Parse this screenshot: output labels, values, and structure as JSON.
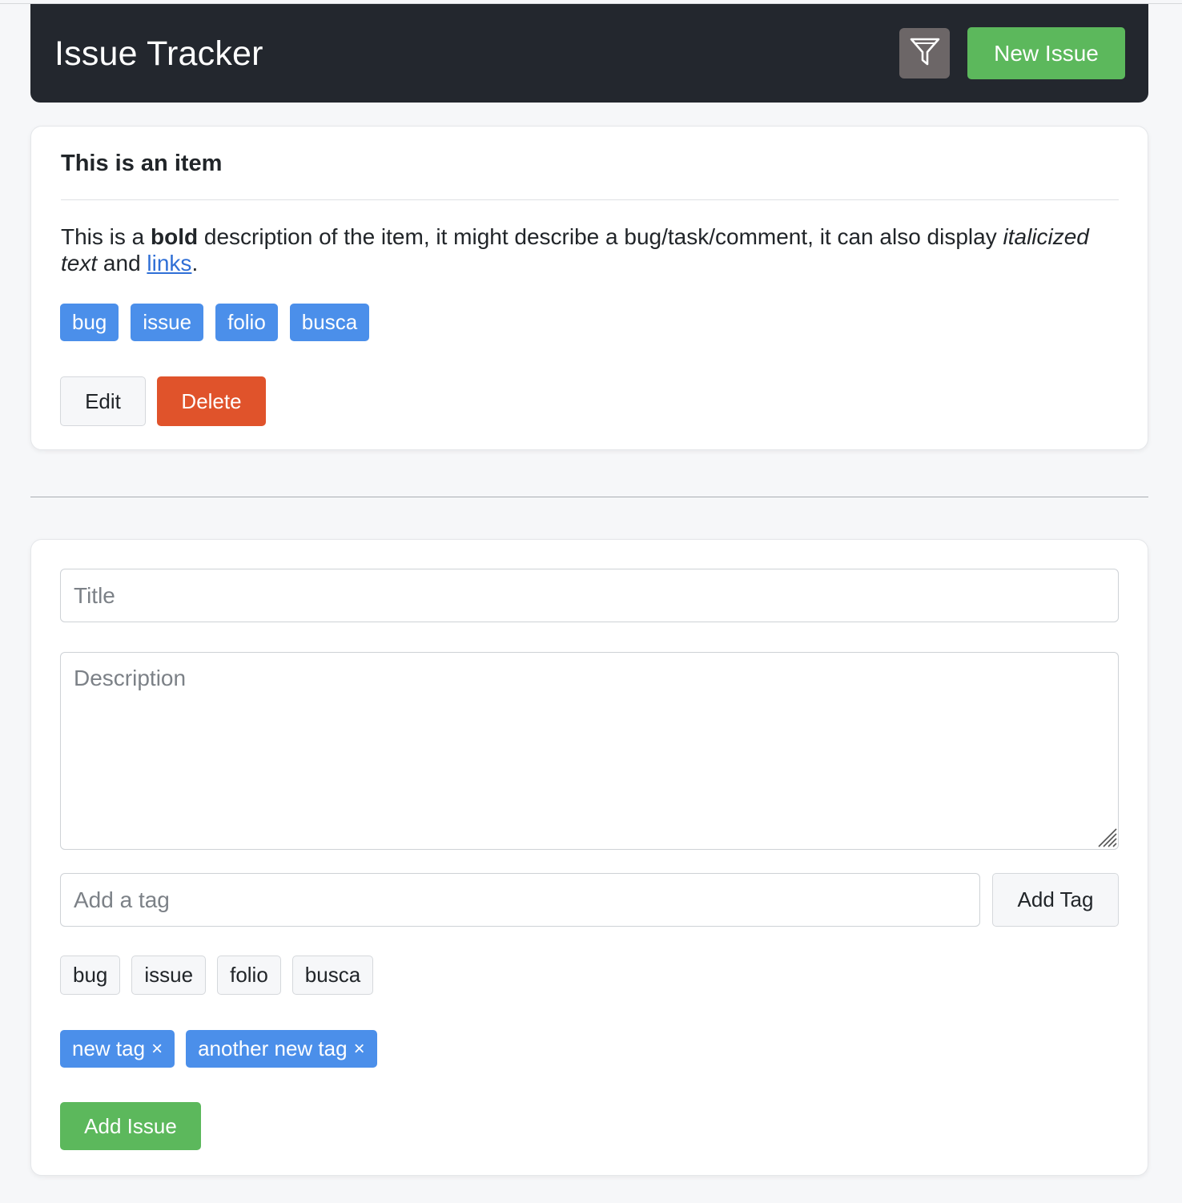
{
  "header": {
    "title": "Issue Tracker",
    "filter_icon": "filter-icon",
    "new_issue_label": "New Issue"
  },
  "item": {
    "title": "This is an item",
    "description": {
      "part1": "This is a ",
      "bold": "bold",
      "part2": " description of the item, it might describe a bug/task/comment, it can also display ",
      "italic": "italicized text",
      "part3": " and ",
      "link": "links",
      "part4": "."
    },
    "tags": [
      "bug",
      "issue",
      "folio",
      "busca"
    ],
    "edit_label": "Edit",
    "delete_label": "Delete"
  },
  "form": {
    "title_placeholder": "Title",
    "description_placeholder": "Description",
    "tag_placeholder": "Add a tag",
    "add_tag_label": "Add Tag",
    "suggested_tags": [
      "bug",
      "issue",
      "folio",
      "busca"
    ],
    "new_tags": [
      "new tag",
      "another new tag"
    ],
    "remove_glyph": "×",
    "add_issue_label": "Add Issue"
  },
  "colors": {
    "header_bg": "#23272e",
    "primary_green": "#5cb85c",
    "danger": "#e0532b",
    "tag_blue": "#4b8fea",
    "link": "#2f6fd6"
  }
}
